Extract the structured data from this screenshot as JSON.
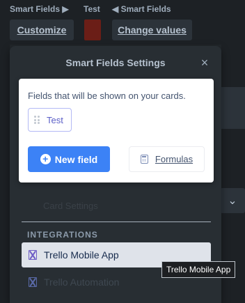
{
  "breadcrumbs": {
    "left": "Smart Fields ▶",
    "middle": "Test",
    "right": "◀ Smart Fields"
  },
  "toolbar": {
    "customize_label": "Customize",
    "change_values_label": "Change values",
    "swatch_color": "#6b1e17"
  },
  "popover": {
    "title": "Smart Fields Settings",
    "close_icon": "×",
    "fields_description": "Fields that will be shown on your cards.",
    "fields": [
      {
        "label": "Test"
      }
    ],
    "new_field_label": "New field",
    "formulas_label": "Formulas",
    "ghost_text": "Card Settings",
    "integrations_heading": "INTEGRATIONS",
    "integrations": [
      {
        "label": "Trello Mobile App",
        "icon": "trello-mobile-icon"
      },
      {
        "label": "Trello Automation",
        "icon": "trello-automation-icon"
      }
    ]
  },
  "tooltip": {
    "text": "Trello Mobile App"
  },
  "colors": {
    "accent_blue": "#3c82f6",
    "chip_text": "#5b5fc7",
    "popover_bg": "#282e33",
    "page_bg": "#22272b"
  }
}
